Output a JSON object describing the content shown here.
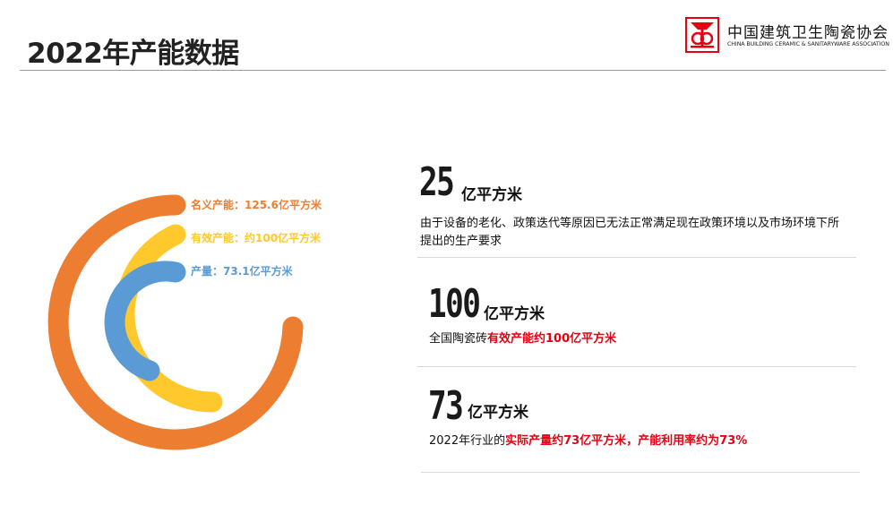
{
  "header": {
    "title": "2022年产能数据",
    "logo_cn": "中国建筑卫生陶瓷协会",
    "logo_en": "CHINA BUILDING CERAMIC & SANITARYWARE ASSOCIATION"
  },
  "rings": {
    "items": [
      {
        "label": "名义产能：125.6亿平方米",
        "color": "#ed7d31"
      },
      {
        "label": "有效产能：约100亿平方米",
        "color": "#ffc82c"
      },
      {
        "label": "产量：73.1亿平方米",
        "color": "#5b9bd5"
      }
    ]
  },
  "stats": [
    {
      "big": "25",
      "unit": "亿平方米",
      "desc": "由于设备的老化、政策迭代等原因已无法正常满足现在政策环境以及市场环境下所提出的生产要求"
    },
    {
      "big": "100",
      "unit": "亿平方米",
      "desc_prefix": "全国陶瓷砖",
      "desc_highlight": "有效产能约100亿平方米"
    },
    {
      "big": "73",
      "unit": "亿平方米",
      "desc_prefix": "2022年行业的",
      "desc_highlight": "实际产量约73亿平方米，产能利用率约为73%"
    }
  ],
  "colors": {
    "highlight": "#e60012",
    "logo_red": "#e60012"
  }
}
